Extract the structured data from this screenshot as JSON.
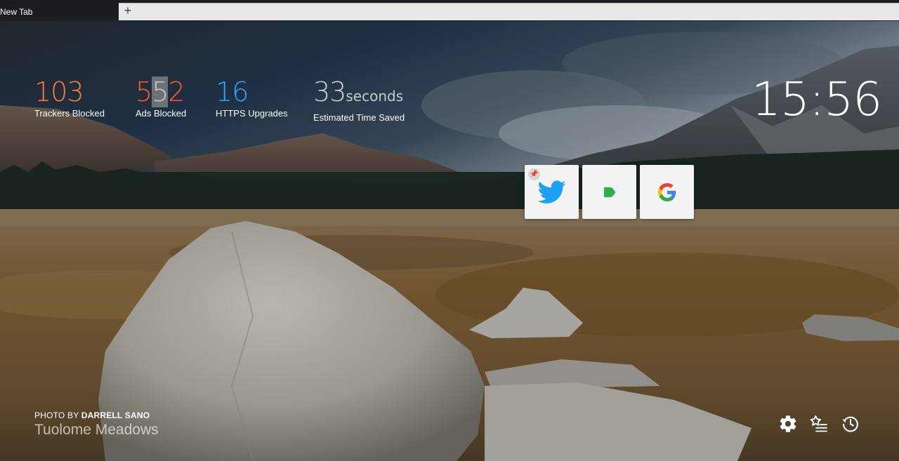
{
  "tab": {
    "title": "New Tab",
    "new_tab_symbol": "+"
  },
  "stats": {
    "trackers": {
      "value": "103",
      "label": "Trackers Blocked",
      "color": "#ff7d3b"
    },
    "ads": {
      "value_pre": "5",
      "value_hl": "5",
      "value_post": "2",
      "label": "Ads Blocked",
      "color": "#ff5a35"
    },
    "https": {
      "value": "16",
      "label": "HTTPS Upgrades",
      "color": "#2aa8ff"
    },
    "time": {
      "value": "33",
      "unit": "seconds",
      "label": "Estimated Time Saved",
      "color": "#cfcfcf"
    }
  },
  "clock": {
    "time": "15:56"
  },
  "top_sites": [
    {
      "name": "Twitter",
      "icon": "twitter-bird-icon",
      "pinned": true
    },
    {
      "name": "Feedly",
      "icon": "feedly-icon",
      "pinned": false
    },
    {
      "name": "Google",
      "icon": "google-g-icon",
      "pinned": false
    }
  ],
  "photo": {
    "prefix": "PHOTO BY",
    "author": "DARRELL SANO",
    "location": "Tuolome Meadows"
  },
  "bottom_icons": [
    "gear-icon",
    "bookmarks-icon",
    "history-icon"
  ]
}
